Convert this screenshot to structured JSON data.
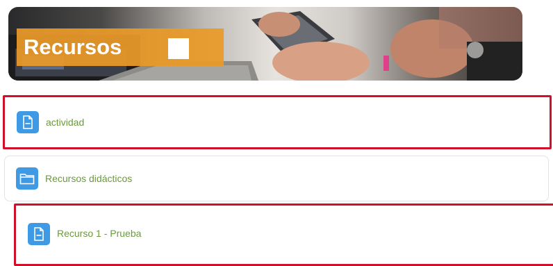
{
  "banner": {
    "title": "Recursos"
  },
  "resources": [
    {
      "label": "actividad",
      "icon": "document-icon",
      "highlighted": true
    },
    {
      "label": "Recursos didácticos",
      "icon": "folder-icon",
      "highlighted": false
    },
    {
      "label": "Recurso 1 - Prueba",
      "icon": "document-icon",
      "highlighted": true
    }
  ],
  "colors": {
    "banner_label": "#e99a28",
    "icon_bg": "#3f9ae6",
    "link_text": "#6a9a3a",
    "highlight_border": "#d0102a"
  }
}
